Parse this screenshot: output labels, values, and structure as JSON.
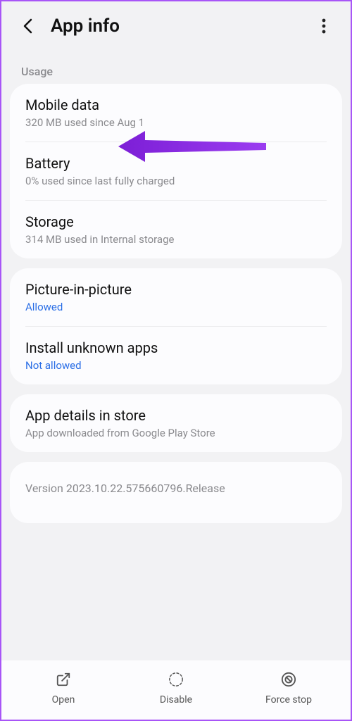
{
  "header": {
    "title": "App info"
  },
  "section": {
    "label": "Usage"
  },
  "usage": {
    "mobileData": {
      "title": "Mobile data",
      "sub": "320 MB used since Aug 1"
    },
    "battery": {
      "title": "Battery",
      "sub": "0% used since last fully charged"
    },
    "storage": {
      "title": "Storage",
      "sub": "314 MB used in Internal storage"
    }
  },
  "perms": {
    "pip": {
      "title": "Picture-in-picture",
      "value": "Allowed"
    },
    "unknown": {
      "title": "Install unknown apps",
      "value": "Not allowed"
    }
  },
  "store": {
    "title": "App details in store",
    "sub": "App downloaded from Google Play Store"
  },
  "version": "Version 2023.10.22.575660796.Release",
  "actions": {
    "open": "Open",
    "disable": "Disable",
    "forceStop": "Force stop"
  }
}
